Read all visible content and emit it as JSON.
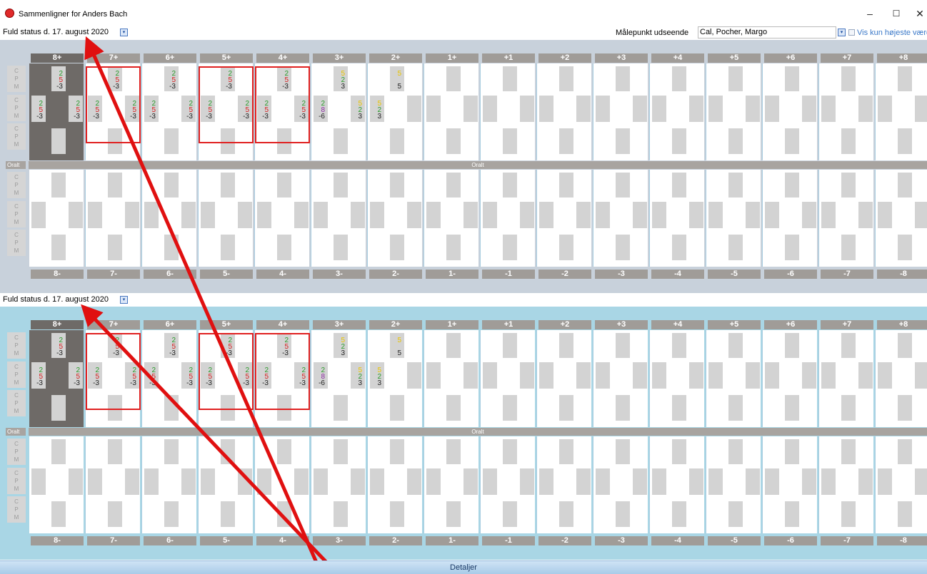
{
  "window": {
    "title": "Sammenligner for Anders Bach",
    "minimize": "–",
    "maximize": "☐",
    "close": "✕"
  },
  "toolbar": {
    "date_selector": "Fuld status d. 17. august 2020",
    "measure_label": "Målepunkt udseende",
    "measure_select": "Cal, Pocher, Margo",
    "only_highest": "Vis kun højeste værdi"
  },
  "panel2": {
    "date_selector": "Fuld status d. 17. august 2020"
  },
  "upper_headers": [
    "8+",
    "7+",
    "6+",
    "5+",
    "4+",
    "3+",
    "2+",
    "1+",
    "+1",
    "+2",
    "+3",
    "+4",
    "+5",
    "+6",
    "+7",
    "+8"
  ],
  "lower_headers": [
    "8-",
    "7-",
    "6-",
    "5-",
    "4-",
    "3-",
    "2-",
    "1-",
    "-1",
    "-2",
    "-3",
    "-4",
    "-5",
    "-6",
    "-7",
    "-8"
  ],
  "cpm": [
    "C",
    "P",
    "M"
  ],
  "oralt": "Oralt",
  "teeth_values": [
    {
      "top": [
        "2",
        "5",
        "-3"
      ],
      "left": [
        "2",
        "5",
        "-3"
      ],
      "right": [
        "2",
        "5",
        "-3"
      ]
    },
    {
      "top": [
        "2",
        "5",
        "-3"
      ],
      "left": [
        "2",
        "5",
        "-3"
      ],
      "right": [
        "2",
        "5",
        "-3"
      ]
    },
    {
      "top": [
        "2",
        "5",
        "-3"
      ],
      "left": [
        "2",
        "5",
        "-3"
      ],
      "right": [
        "2",
        "5",
        "-3"
      ]
    },
    {
      "top": [
        "2",
        "5",
        "-3"
      ],
      "left": [
        "2",
        "5",
        "-3"
      ],
      "right": [
        "2",
        "5",
        "-3"
      ]
    },
    {
      "top": [
        "2",
        "5",
        "-3"
      ],
      "left": [
        "2",
        "5",
        "-3"
      ],
      "right": [
        "2",
        "5",
        "-3"
      ]
    },
    {
      "top": [
        "5",
        "2",
        "3"
      ],
      "left": [
        "2",
        "8",
        "-6"
      ],
      "right": [
        "5",
        "2",
        "3"
      ]
    },
    {
      "top": [
        "5",
        "",
        "5"
      ],
      "left": [
        "5",
        "2",
        "3"
      ],
      "right": [
        "",
        "",
        ""
      ]
    }
  ],
  "value_colors": {
    "c": "#2a9a2a",
    "p": "#d42020",
    "m": "#222222",
    "yellow": "#e8c400",
    "purple": "#8a2aa0"
  },
  "footer": {
    "details": "Detaljer"
  }
}
